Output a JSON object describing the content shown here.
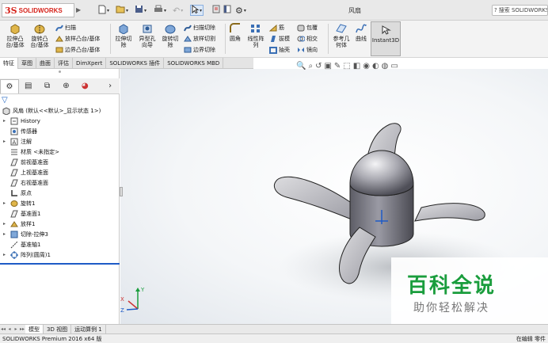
{
  "app": {
    "logo_ds": "3S",
    "logo_text": "SOLIDWORKS",
    "doc_title": "风扇",
    "search_placeholder": "搜索 SOLIDWORKS"
  },
  "command_manager": {
    "big_buttons": [
      {
        "id": "extrude-boss",
        "label": "拉伸凸\n台/基体"
      },
      {
        "id": "revolve-boss",
        "label": "旋转凸\n台/基体"
      },
      {
        "id": "extrude-cut",
        "label": "拉伸切\n除"
      },
      {
        "id": "hole-wizard",
        "label": "异型孔\n向导"
      },
      {
        "id": "revolve-cut",
        "label": "旋转切\n除"
      },
      {
        "id": "fillet",
        "label": "圆角"
      },
      {
        "id": "linear-pattern",
        "label": "线性阵\n列"
      },
      {
        "id": "reference-geometry",
        "label": "参考几\n何体"
      },
      {
        "id": "curves",
        "label": "曲线"
      }
    ],
    "small_buttons": [
      {
        "id": "sweep",
        "label": "扫描"
      },
      {
        "id": "loft",
        "label": "放样凸台/基体"
      },
      {
        "id": "boundary-boss",
        "label": "边界凸台/基体"
      },
      {
        "id": "swept-cut",
        "label": "扫描切除"
      },
      {
        "id": "lofted-cut",
        "label": "放样切割"
      },
      {
        "id": "boundary-cut",
        "label": "边界切除"
      },
      {
        "id": "rib",
        "label": "筋"
      },
      {
        "id": "draft",
        "label": "拔模"
      },
      {
        "id": "shell",
        "label": "抽壳"
      },
      {
        "id": "wrap",
        "label": "包覆"
      },
      {
        "id": "intersect",
        "label": "相交"
      },
      {
        "id": "mirror",
        "label": "镜向"
      }
    ],
    "instant3d": "Instant3D"
  },
  "tabs": [
    "特征",
    "草图",
    "曲面",
    "评估",
    "DimXpert",
    "SOLIDWORKS 插件",
    "SOLIDWORKS MBD"
  ],
  "active_tab": "特征",
  "tree": [
    {
      "id": "root",
      "label": "风扇 (默认<<默认>_显示状态 1>)",
      "expand": "",
      "indent": 0
    },
    {
      "id": "history",
      "label": "History",
      "expand": "▸",
      "indent": 1
    },
    {
      "id": "sensors",
      "label": "传感器",
      "expand": "",
      "indent": 1
    },
    {
      "id": "annotations",
      "label": "注解",
      "expand": "▸",
      "indent": 1
    },
    {
      "id": "material",
      "label": "材质 <未指定>",
      "expand": "",
      "indent": 1
    },
    {
      "id": "front-plane",
      "label": "前视基准面",
      "expand": "",
      "indent": 1
    },
    {
      "id": "top-plane",
      "label": "上视基准面",
      "expand": "",
      "indent": 1
    },
    {
      "id": "right-plane",
      "label": "右视基准面",
      "expand": "",
      "indent": 1
    },
    {
      "id": "origin",
      "label": "原点",
      "expand": "",
      "indent": 1
    },
    {
      "id": "revolve1",
      "label": "旋转1",
      "expand": "▸",
      "indent": 1
    },
    {
      "id": "plane1",
      "label": "基准面1",
      "expand": "",
      "indent": 1
    },
    {
      "id": "loft1",
      "label": "放样1",
      "expand": "▸",
      "indent": 1
    },
    {
      "id": "cut-extrude3",
      "label": "切除-拉伸3",
      "expand": "▸",
      "indent": 1
    },
    {
      "id": "axis1",
      "label": "基准轴1",
      "expand": "",
      "indent": 1
    },
    {
      "id": "pattern1",
      "label": "阵列(圆周)1",
      "expand": "▸",
      "indent": 1
    }
  ],
  "bottom_tabs": [
    "模型",
    "3D 视图",
    "运动算例 1"
  ],
  "active_bottom_tab": "模型",
  "status": {
    "left": "SOLIDWORKS Premium 2016 x64 版",
    "right": "在编辑 零件"
  },
  "watermark": {
    "big": "百科全说",
    "small": "助你轻松解决"
  },
  "triad": {
    "x": "X",
    "y": "Y",
    "z": "Z"
  },
  "colors": {
    "brand_red": "#d6231b",
    "watermark_green": "#1a9d3d",
    "selection_blue": "#1e5bc6"
  }
}
